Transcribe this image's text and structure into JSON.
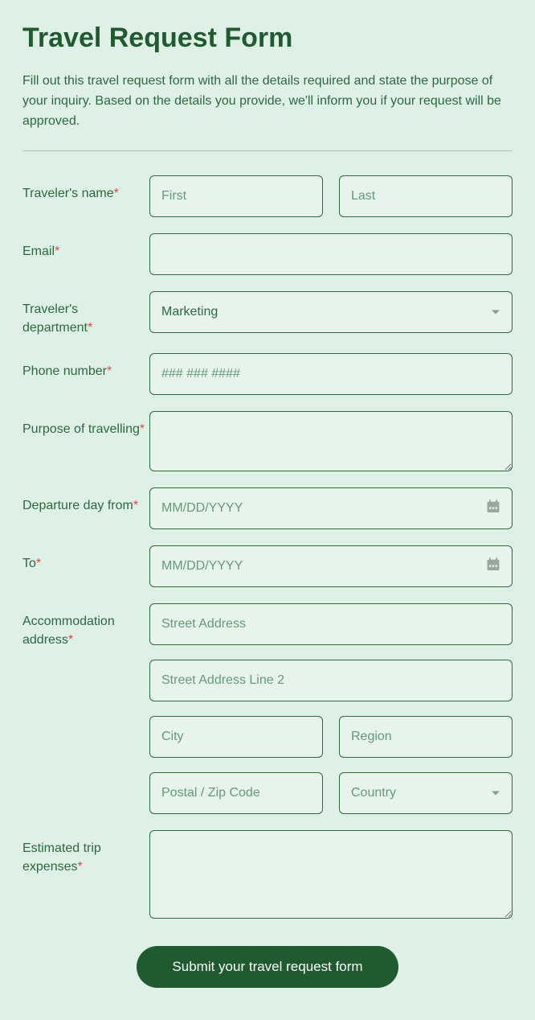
{
  "title": "Travel Request Form",
  "intro": "Fill out this travel request form with all the details required and state the purpose of your inquiry. Based on the details you provide, we'll inform you if your request will be approved.",
  "labels": {
    "name": "Traveler's name",
    "email": "Email",
    "department": "Traveler's department",
    "phone": "Phone number",
    "purpose": "Purpose of travelling",
    "dep_from": "Departure day from",
    "to": "To",
    "accom": "Accommodation address",
    "expenses": "Estimated trip expenses"
  },
  "placeholders": {
    "first": "First",
    "last": "Last",
    "phone": "### ### ####",
    "date": "MM/DD/YYYY",
    "street1": "Street Address",
    "street2": "Street Address Line 2",
    "city": "City",
    "region": "Region",
    "postal": "Postal / Zip Code",
    "country": "Country"
  },
  "department_value": "Marketing",
  "submit": "Submit your travel request form"
}
